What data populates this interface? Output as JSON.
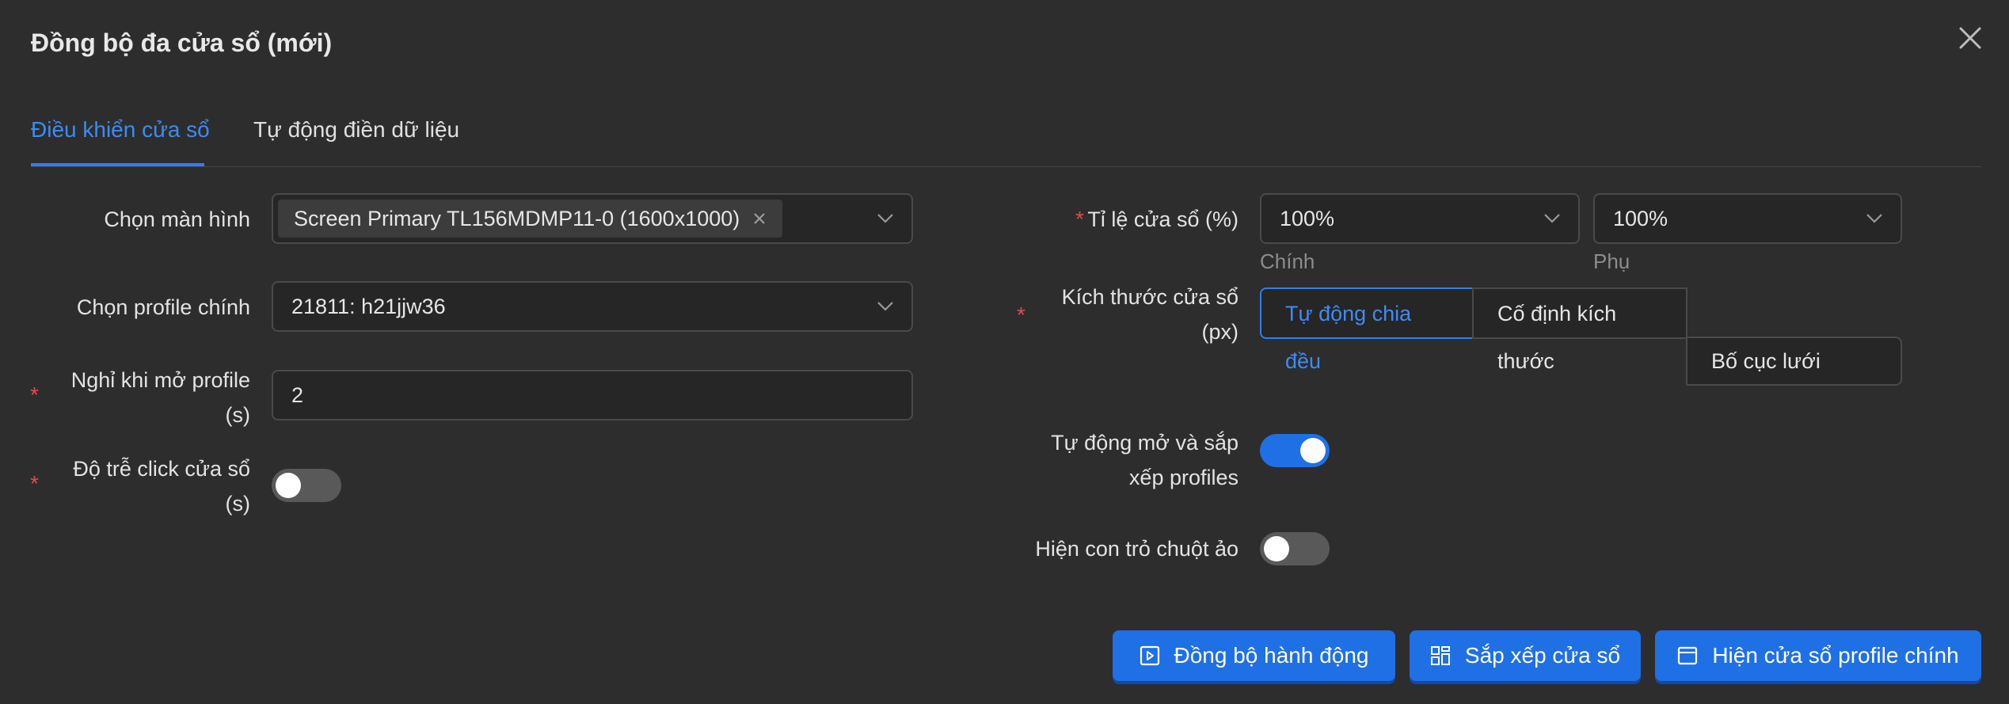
{
  "dialog": {
    "title": "Đồng bộ đa cửa sổ (mới)"
  },
  "tabs": [
    {
      "label": "Điều khiển cửa sổ",
      "active": true
    },
    {
      "label": "Tự động điền dữ liệu",
      "active": false
    }
  ],
  "left_form": {
    "screen": {
      "label": "Chọn màn hình",
      "selected_tag": "Screen Primary TL156MDMP11-0 (1600x1000)"
    },
    "main_profile": {
      "label": "Chọn profile chính",
      "value": "21811: h21jjw36"
    },
    "open_delay": {
      "required_mark": "*",
      "label_line1": "Nghỉ khi mở profile",
      "label_line2": "(s)",
      "value": "2"
    },
    "click_delay": {
      "required_mark": "*",
      "label_line1": "Độ trễ click cửa sổ",
      "label_line2": "(s)",
      "enabled": false
    }
  },
  "right_form": {
    "ratio": {
      "required_mark": "*",
      "label": "Tỉ lệ cửa sổ (%)",
      "main_value": "100%",
      "main_hint": "Chính",
      "sub_value": "100%",
      "sub_hint": "Phụ"
    },
    "size": {
      "required_mark": "*",
      "label_line1": "Kích thước cửa sổ",
      "label_line2": "(px)",
      "options": [
        {
          "line1": "Tự động chia",
          "line2": "đều",
          "selected": true
        },
        {
          "line1": "Cố định kích",
          "line2": "thước",
          "selected": false
        },
        {
          "line1": "Bố cục lưới",
          "selected": false
        }
      ]
    },
    "auto_arrange": {
      "label_line1": "Tự động mở và sắp",
      "label_line2": "xếp profiles",
      "enabled": true
    },
    "virtual_cursor": {
      "label": "Hiện con trỏ chuột ảo",
      "enabled": false
    }
  },
  "footer": {
    "sync_button": "Đồng bộ hành động",
    "arrange_button": "Sắp xếp cửa sổ",
    "show_main_button": "Hiện cửa sổ profile chính"
  },
  "colors": {
    "accent": "#1f6fe5",
    "tab_active": "#3b8cf5",
    "required": "#e5484d",
    "background": "#2d2d2d"
  }
}
